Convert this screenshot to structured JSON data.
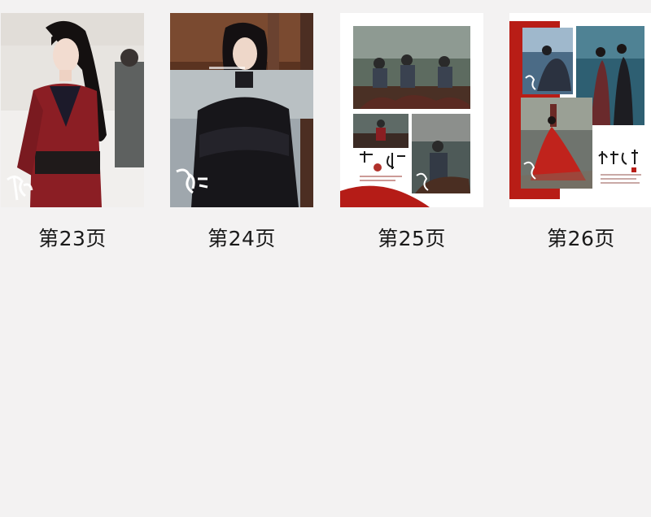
{
  "pages": [
    {
      "label": "第23页",
      "thumbnail": "photo-woman-red-robe-ponytail"
    },
    {
      "label": "第24页",
      "thumbnail": "photo-man-black-robe-arms-crossed"
    },
    {
      "label": "第25页",
      "thumbnail": "collage-soldiers-on-horseback"
    },
    {
      "label": "第26页",
      "thumbnail": "collage-red-dress-night-scene"
    }
  ]
}
